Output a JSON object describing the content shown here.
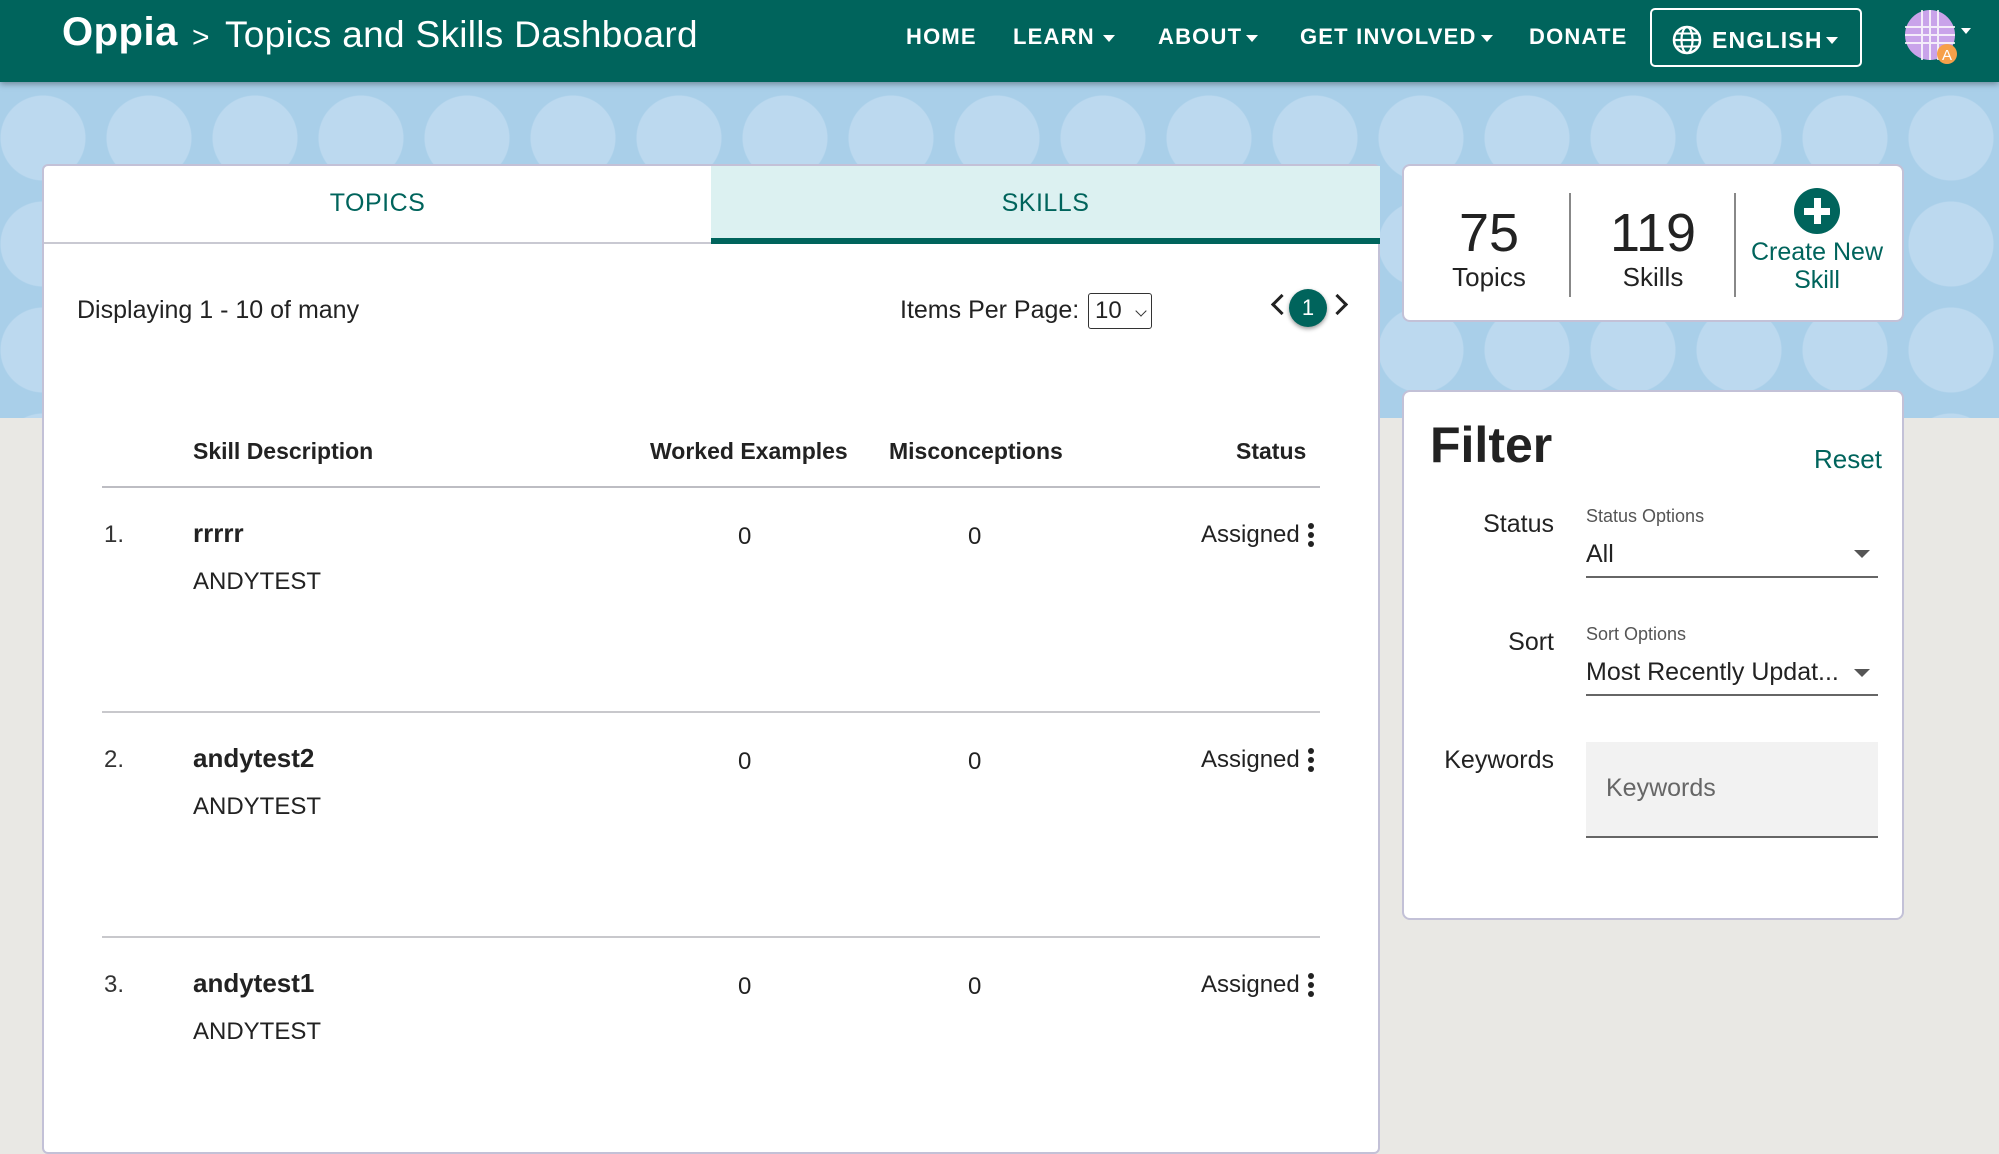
{
  "header": {
    "logo": "Oppia",
    "separator": ">",
    "title": "Topics and Skills Dashboard",
    "nav": {
      "home": "HOME",
      "learn": "LEARN",
      "about": "ABOUT",
      "get_involved": "GET INVOLVED",
      "donate": "DONATE"
    },
    "language": "ENGLISH",
    "avatar_badge": "A"
  },
  "tabs": {
    "topics": "TOPICS",
    "skills": "SKILLS",
    "active": "SKILLS"
  },
  "pagination": {
    "display_text": "Displaying 1 - 10 of many",
    "items_per_page_label": "Items Per Page:",
    "items_per_page_value": "10",
    "current_page": "1"
  },
  "table": {
    "headers": {
      "description": "Skill Description",
      "worked_examples": "Worked Examples",
      "misconceptions": "Misconceptions",
      "status": "Status"
    },
    "rows": [
      {
        "index": "1.",
        "name": "rrrrr",
        "topic": "ANDYTEST",
        "worked_examples": "0",
        "misconceptions": "0",
        "status": "Assigned"
      },
      {
        "index": "2.",
        "name": "andytest2",
        "topic": "ANDYTEST",
        "worked_examples": "0",
        "misconceptions": "0",
        "status": "Assigned"
      },
      {
        "index": "3.",
        "name": "andytest1",
        "topic": "ANDYTEST",
        "worked_examples": "0",
        "misconceptions": "0",
        "status": "Assigned"
      }
    ]
  },
  "stats": {
    "topics_count": "75",
    "topics_label": "Topics",
    "skills_count": "119",
    "skills_label": "Skills",
    "create_label_line1": "Create New",
    "create_label_line2": "Skill"
  },
  "filter": {
    "title": "Filter",
    "reset": "Reset",
    "status_label": "Status",
    "status_small": "Status Options",
    "status_value": "All",
    "sort_label": "Sort",
    "sort_small": "Sort Options",
    "sort_value": "Most Recently Updat...",
    "keywords_label": "Keywords",
    "keywords_placeholder": "Keywords"
  },
  "colors": {
    "brand": "#00645c",
    "banner": "#a9cfe9",
    "active_tab": "#dcf1f1"
  }
}
